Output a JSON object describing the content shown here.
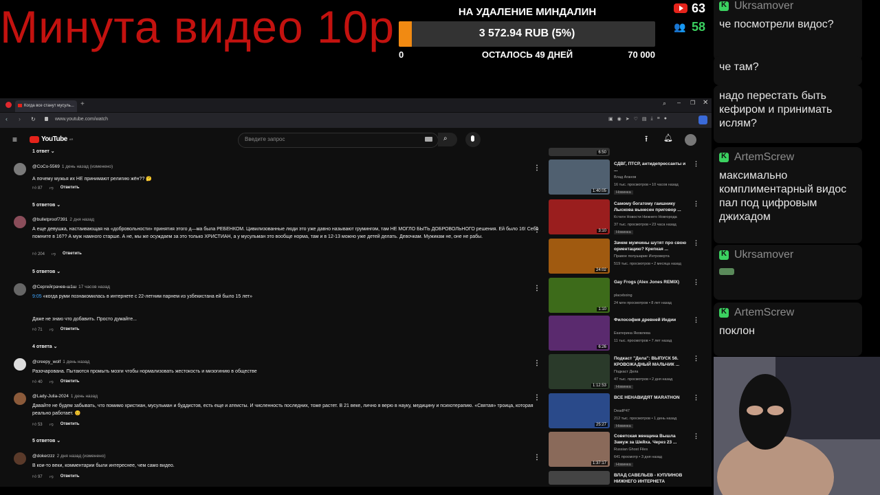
{
  "overlay": {
    "headline": "Минута видео 10р",
    "donation": {
      "title": "НА УДАЛЕНИЕ МИНДАЛИН",
      "amount": "3 572.94 RUB (5%)",
      "progress_percent": 5,
      "min": "0",
      "remaining": "ОСТАЛОСЬ 49 ДНЕЙ",
      "max": "70 000"
    },
    "youtube_viewers": "63",
    "kick_viewers": "58"
  },
  "chat": [
    {
      "user": "Ukrsamover",
      "text": "че посмотрели видос?"
    },
    {
      "user": "",
      "text": "че там?"
    },
    {
      "user": "",
      "text": "надо перестать быть кефиром и принимать ислям?"
    },
    {
      "user": "ArtemScrew",
      "text": "максимально комплиментарный видос пал под цифровым джихадом"
    },
    {
      "user": "Ukrsamover",
      "text": ""
    },
    {
      "user": "ArtemScrew",
      "text": "поклон"
    }
  ],
  "browser": {
    "tab_title": "Когда все станут мусуль...",
    "url": "www.youtube.com/watch",
    "search_placeholder": "Введите запрос",
    "logo": "YouTube",
    "logo_region": "AR"
  },
  "comments_top_replies": "1 ответ",
  "comments": [
    {
      "user": "@CoCo-5569",
      "time": "1 день назад (изменено)",
      "text": "А почему мужья их НЕ принимают религию жён?? 🤔",
      "likes": "87",
      "reply": "Ответить",
      "replies": "5 ответов"
    },
    {
      "user": "@bulletproof7391",
      "time": "2 дня назад",
      "text": "А еще девушка, настаивающая на «добровольности» принятия этого д—ма была РЕБЕНКОМ. Цивилизованные люди это уже давно называют грумингом, там НЕ МОГЛО БЫТЬ ДОБРОВОЛЬНОГО решения. Ей было 16! Себя помните в 16?? А муж намного старше. А не, мы же осуждаем за это только ХРИСТИАН, а у мусульман это вообще норма, там и в 12-13 можно уже детей делать. Девочкам. Мужикам не, оне не рабы.",
      "likes": "204",
      "reply": "Ответить",
      "replies": "5 ответов"
    },
    {
      "user": "@Сергейграчев-ш1ш",
      "time": "17 часов назад",
      "timestamp": "9:05",
      "text": "«когда руми познакомилась в интернете с 22-летним парнем из узбекистана ей было 15 лет»",
      "text2": "Даже не знаю что добавить. Просто думайте...",
      "likes": "71",
      "reply": "Ответить",
      "replies": "4 ответа"
    },
    {
      "user": "@creepy_wolf",
      "time": "1 день назад",
      "text": "Разочарована. Пытаются промыть мозги чтобы нормализовать жестокость и мизогинию в обществе",
      "likes": "40",
      "reply": "Ответить",
      "replies": ""
    },
    {
      "user": "@Lady-Julia-2024",
      "time": "1 день назад",
      "text": "Давайте не будем забывать, что помимо христиан, мусульман и буддистов, есть еще и атеисты. И численность последних, тоже растет. В 21 веке, лично я верю в науку, медицину и психотерапию. «Святая» троица, которая реально работает. 😊",
      "likes": "53",
      "reply": "Ответить",
      "replies": "5 ответов"
    },
    {
      "user": "@dokerzzz",
      "time": "2 дня назад (изменено)",
      "text": "В кои-то веки, комментарии были интереснее, чем само видео.",
      "likes": "97",
      "reply": "Ответить",
      "replies": ""
    }
  ],
  "videos": [
    {
      "title": "СДВГ, ПТСР, антидепрессанты и ...",
      "channel": "Влад Аганов",
      "meta": "16 тыс. просмотров • 10 часов назад",
      "badge": "Новинка",
      "duration": "1:40:05",
      "color": "#506070"
    },
    {
      "title": "Самому богатому гаишнику Лыскова вынесен приговор ...",
      "channel": "Кстати Новости Нижнего Новгорода",
      "meta": "37 тыс. просмотров • 23 часа назад",
      "badge": "Новинка",
      "duration": "3:10",
      "color": "#9a1e1e"
    },
    {
      "title": "Зачем мужчины шутят про свою ориентацию? Крепкая ...",
      "channel": "Правое полушарие Интроверта",
      "meta": "519 тыс. просмотров • 2 месяца назад",
      "badge": "",
      "duration": "24:02",
      "color": "#a05a10"
    },
    {
      "title": "Gay Frogs (Alex Jones REMIX)",
      "channel": "placeboing",
      "meta": "24 млн просмотров • 8 лет назад",
      "badge": "",
      "duration": "1:10",
      "color": "#3d6b1a"
    },
    {
      "title": "Философия древней Индии",
      "channel": "Екатерина Яковлева",
      "meta": "11 тыс. просмотров • 7 лет назад",
      "badge": "",
      "duration": "6:26",
      "color": "#5a2a6e"
    },
    {
      "title": "Подкаст \"Дела\": ВЫПУСК 56. КРОВОЖАДНЫЙ МАЛЬЧИК ...",
      "channel": "Подкаст Дела",
      "meta": "47 тыс. просмотров • 2 дня назад",
      "badge": "Новинка",
      "duration": "1:12:53",
      "color": "#2a3a2a"
    },
    {
      "title": "ВСЕ НЕНАВИДЯТ MARATHON",
      "channel": "DeadP47",
      "meta": "212 тыс. просмотров • 1 день назад",
      "badge": "Новинка",
      "duration": "25:27",
      "color": "#2a4a8a"
    },
    {
      "title": "Советская женщина Вышла Замуж за Шейха. Через 23 ...",
      "channel": "Russian Ghost Files",
      "meta": "641 просмотр • 3 дня назад",
      "badge": "Новинка",
      "duration": "1:37:17",
      "color": "#8a6a5a"
    },
    {
      "title": "ВЛАД САВЕЛЬЕВ - КУПЛИНОВ НИЖНЕГО ИНТЕРНЕТА",
      "channel": "",
      "meta": "",
      "badge": "",
      "duration": "",
      "color": "#444"
    }
  ]
}
